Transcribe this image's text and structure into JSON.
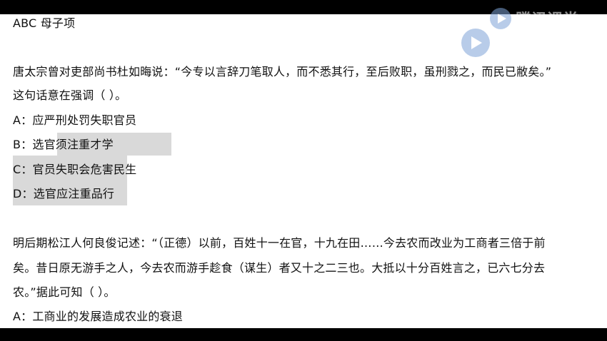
{
  "doc": {
    "heading": "ABC 母子项",
    "q1": {
      "stem_line1": "唐太宗曾对吏部尚书杜如晦说：“今专以言辞刀笔取人，而不悉其行，至后败职，虽刑戮之，而民已敝矣。”",
      "stem_line2": "这句话意在强调（  ）。",
      "options": [
        "A：应严刑处罚失职官员",
        "B：选官须注重才学",
        "C：官员失职会危害民生",
        "D：选官应注重品行"
      ]
    },
    "q2": {
      "stem_line1": "明后期松江人何良俊记述：“（正德）以前，百姓十一在官，十九在田……今去农而改业为工商者三倍于前",
      "stem_line2": "矣。昔日原无游手之人，今去农而游手趁食（谋生）者又十之二三也。大抵以十分百姓言之，已六七分去",
      "stem_line3": "农。”据此可知（  ）。",
      "option_a": "A：工商业的发展造成农业的衰退"
    }
  },
  "watermark": {
    "text": "腾讯课堂"
  }
}
